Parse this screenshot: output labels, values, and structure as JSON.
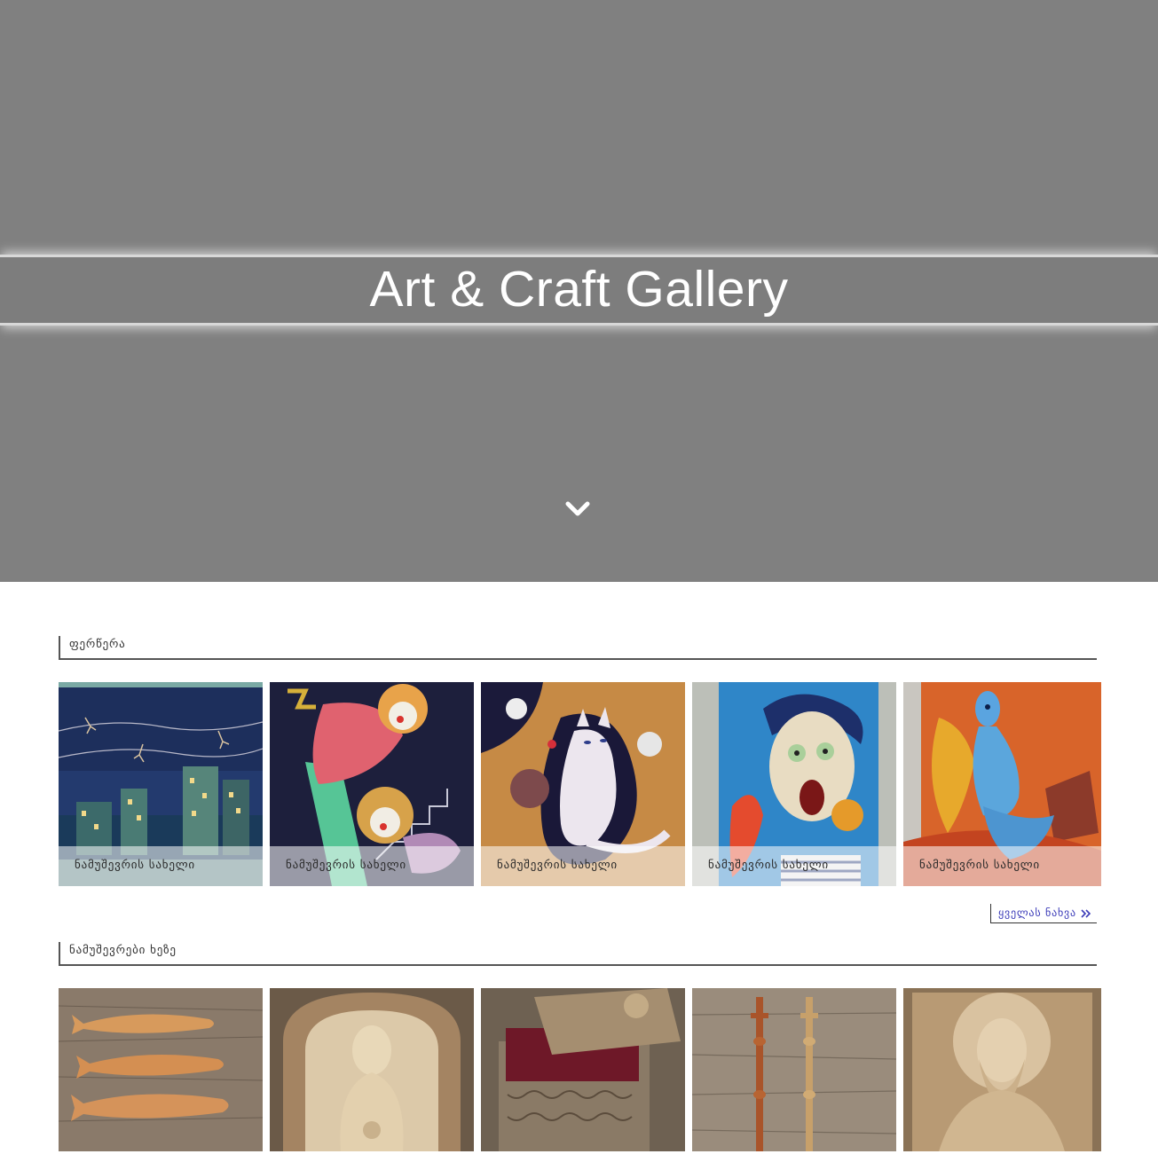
{
  "hero": {
    "title": "Art & Craft Gallery",
    "scroll_icon": "chevron-down-icon"
  },
  "sections": [
    {
      "heading": "ფერწერა",
      "items": [
        {
          "caption": "ნამუშევრის სახელი",
          "image": "night-city-acrobats-painting"
        },
        {
          "caption": "ნამუშევრის სახელი",
          "image": "clowns-painting"
        },
        {
          "caption": "ნამუშევრის სახელი",
          "image": "cat-girl-painting"
        },
        {
          "caption": "ნამუშევრის სახელი",
          "image": "screaming-face-fish-painting"
        },
        {
          "caption": "ნამუშევრის სახელი",
          "image": "blue-angel-painting"
        }
      ],
      "see_all": "ყველას ნახვა",
      "see_all_icon": "double-chevron-right-icon"
    },
    {
      "heading": "ნამუშევრები ხეზე",
      "items": [
        {
          "image": "carved-wooden-fish"
        },
        {
          "image": "carved-madonna-icon"
        },
        {
          "image": "carved-wooden-box"
        },
        {
          "image": "wooden-crosses"
        },
        {
          "image": "carved-saint-icon"
        }
      ]
    }
  ],
  "colors": {
    "hero_bg": "#808080",
    "link": "#3a3ab8"
  }
}
